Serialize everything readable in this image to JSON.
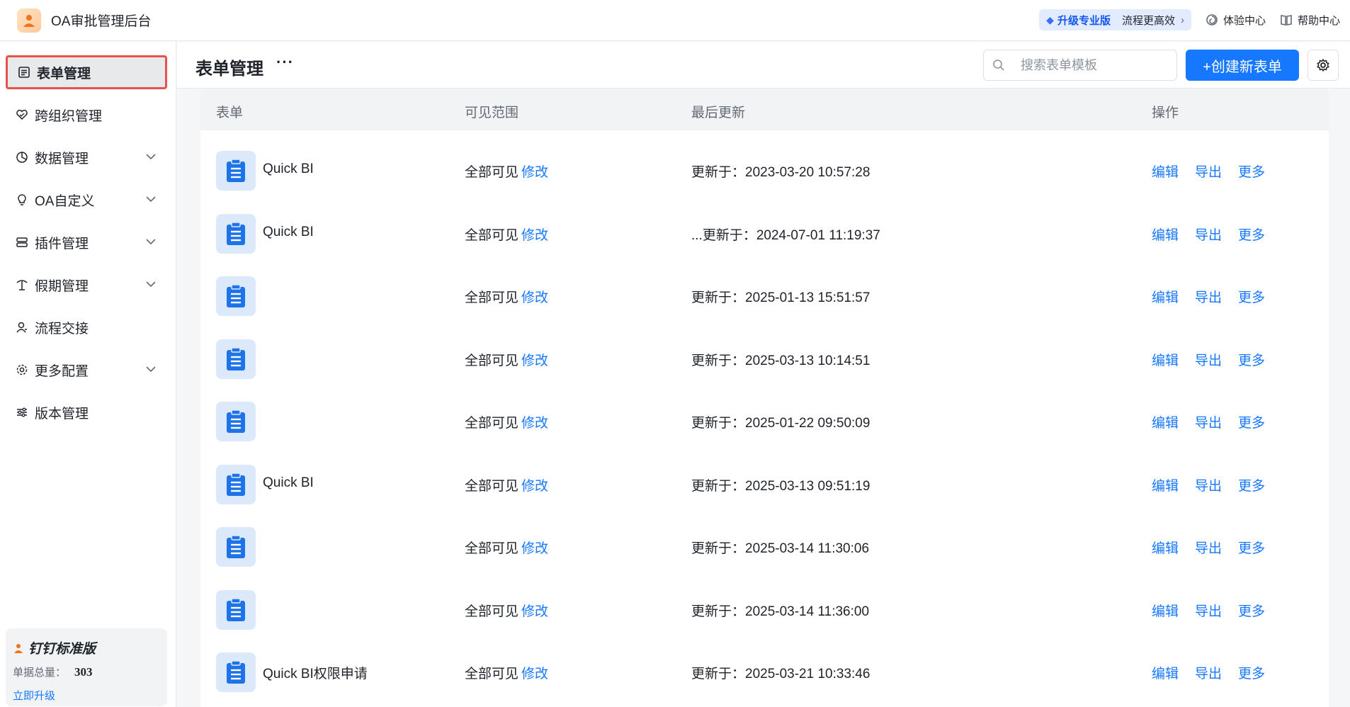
{
  "app": {
    "title": "OA审批管理后台",
    "promo_upgrade": "升级专业版",
    "promo_slogan": "流程更高效",
    "experience_center": "体验中心",
    "help_center": "帮助中心"
  },
  "sidebar": {
    "items": [
      {
        "label": "表单管理",
        "icon": "form-icon",
        "active": true,
        "has_children": false
      },
      {
        "label": "跨组织管理",
        "icon": "heart-link-icon",
        "active": false,
        "has_children": false
      },
      {
        "label": "数据管理",
        "icon": "pie-chart-icon",
        "active": false,
        "has_children": true
      },
      {
        "label": "OA自定义",
        "icon": "bulb-icon",
        "active": false,
        "has_children": true
      },
      {
        "label": "插件管理",
        "icon": "plugin-icon",
        "active": false,
        "has_children": true
      },
      {
        "label": "假期管理",
        "icon": "palm-tree-icon",
        "active": false,
        "has_children": true
      },
      {
        "label": "流程交接",
        "icon": "user-transfer-icon",
        "active": false,
        "has_children": false
      },
      {
        "label": "更多配置",
        "icon": "gear-icon",
        "active": false,
        "has_children": true
      },
      {
        "label": "版本管理",
        "icon": "sliders-icon",
        "active": false,
        "has_children": false
      }
    ],
    "plan": {
      "name": "钉钉标准版",
      "count_label": "单据总量：",
      "count_value": "303",
      "upgrade_label": "立即升级"
    }
  },
  "header": {
    "title": "表单管理",
    "more": "···",
    "search_placeholder": "搜索表单模板",
    "create_label": "+创建新表单"
  },
  "table": {
    "columns": [
      "表单",
      "可见范围",
      "最后更新",
      "操作"
    ],
    "scope_edit_label": "修改",
    "actions": [
      "编辑",
      "导出",
      "更多"
    ],
    "rows": [
      {
        "name": "Quick BI",
        "scope": "全部可见",
        "updated": "更新于：2023-03-20 10:57:28"
      },
      {
        "name": "Quick BI",
        "scope": "全部可见",
        "updated": "...更新于：2024-07-01 11:19:37"
      },
      {
        "name": "",
        "scope": "全部可见",
        "updated": "更新于：2025-01-13 15:51:57"
      },
      {
        "name": "",
        "scope": "全部可见",
        "updated": "更新于：2025-03-13 10:14:51"
      },
      {
        "name": "",
        "scope": "全部可见",
        "updated": "更新于：2025-01-22 09:50:09"
      },
      {
        "name": "Quick BI",
        "scope": "全部可见",
        "updated": "更新于：2025-03-13 09:51:19"
      },
      {
        "name": "",
        "scope": "全部可见",
        "updated": "更新于：2025-03-14 11:30:06"
      },
      {
        "name": "",
        "scope": "全部可见",
        "updated": "更新于：2025-03-14 11:36:00"
      },
      {
        "name": "Quick BI权限申请",
        "scope": "全部可见",
        "updated": "更新于：2025-03-21 10:33:46"
      }
    ]
  }
}
